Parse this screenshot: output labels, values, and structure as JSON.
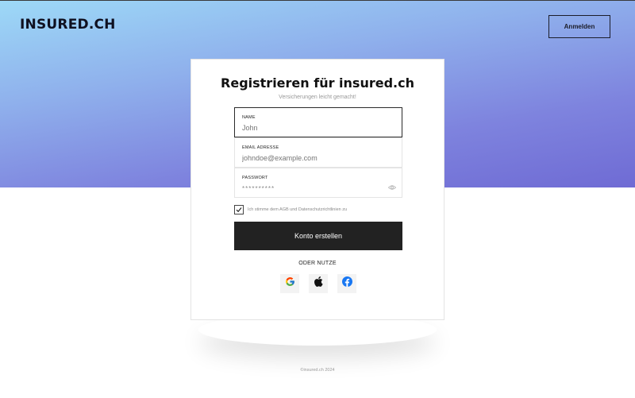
{
  "brand": {
    "logo_text": "INSURED.CH"
  },
  "header": {
    "login_label": "Anmelden"
  },
  "form": {
    "title": "Registrieren für insured.ch",
    "subtitle": "Versicherungen leicht gemacht!",
    "fields": [
      {
        "label": "NAME",
        "value": "",
        "placeholder": "John"
      },
      {
        "label": "EMAIL ADRESSE",
        "value": "",
        "placeholder": "johndoe@example.com"
      },
      {
        "label": "PASSWORT",
        "value": "**********",
        "placeholder": ""
      }
    ],
    "terms_label": "Ich stimme dem AGB und Datenschutzrichtlinien zu",
    "terms_checked": true,
    "submit_label": "Konto erstellen",
    "social_label": "ODER NUTZE",
    "social_icons": [
      "google-icon",
      "apple-icon",
      "facebook-icon"
    ]
  },
  "footer": {
    "copyright": "©insured.ch 2024"
  },
  "colors": {
    "hero_top": "#9dd9f7",
    "hero_bottom": "#6f6bd4",
    "primary_button": "#222222",
    "facebook": "#1877f2"
  }
}
